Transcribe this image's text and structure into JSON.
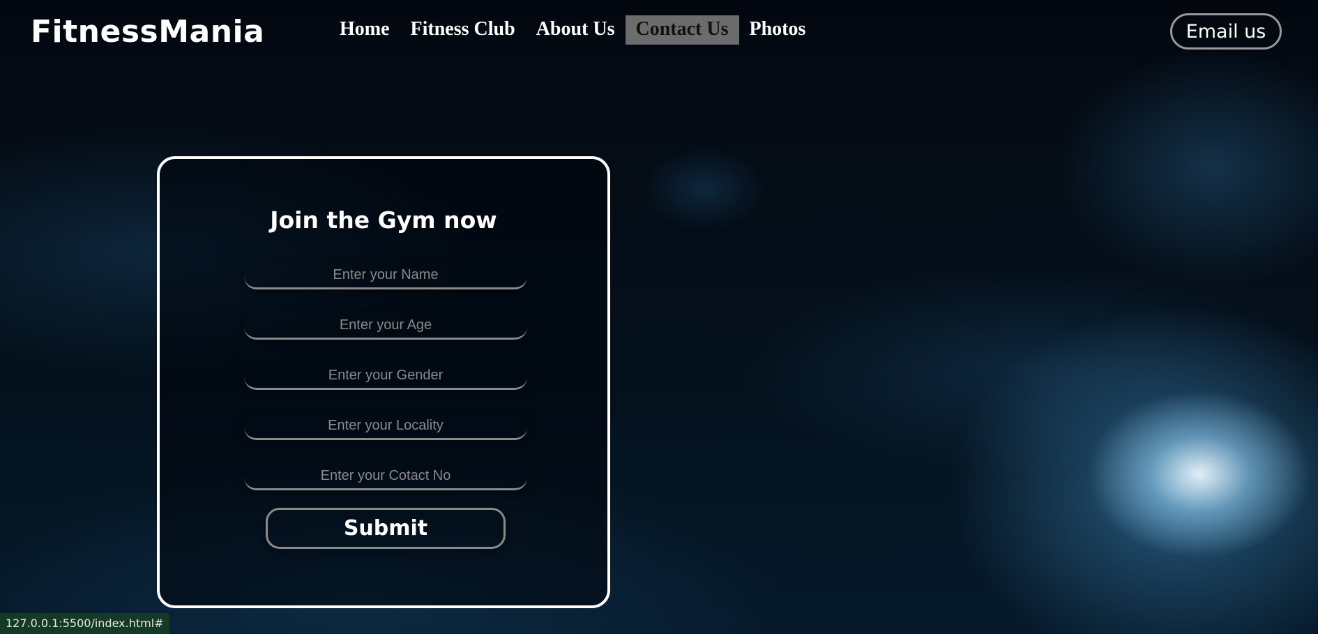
{
  "header": {
    "logo": "FitnessMania",
    "nav": [
      {
        "label": "Home",
        "active": false
      },
      {
        "label": "Fitness Club",
        "active": false
      },
      {
        "label": "About Us",
        "active": false
      },
      {
        "label": "Contact Us",
        "active": true
      },
      {
        "label": "Photos",
        "active": false
      }
    ],
    "email_button": "Email us"
  },
  "form": {
    "title": "Join the Gym now",
    "fields": [
      {
        "placeholder": "Enter your Name",
        "value": ""
      },
      {
        "placeholder": "Enter your Age",
        "value": ""
      },
      {
        "placeholder": "Enter your Gender",
        "value": ""
      },
      {
        "placeholder": "Enter your Locality",
        "value": ""
      },
      {
        "placeholder": "Enter your Cotact No",
        "value": ""
      }
    ],
    "submit_label": "Submit"
  },
  "status_bar": {
    "url": "127.0.0.1:5500/index.html#"
  },
  "colors": {
    "nav_active_bg": "#6c6c6c",
    "border_gray": "#8a8a8a",
    "status_bg": "#143a26"
  }
}
